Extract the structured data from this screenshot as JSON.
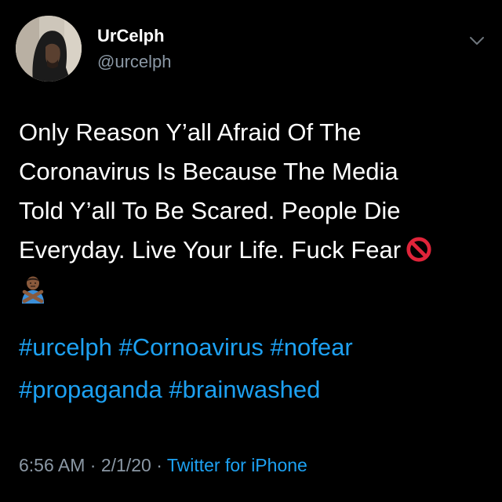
{
  "user": {
    "display_name": "UrCelph",
    "handle": "@urcelph"
  },
  "tweet": {
    "lines": [
      "Only Reason Y’all Afraid Of The",
      "Coronavirus Is Because The Media",
      "Told Y’all To Be Scared. People Die",
      "Everyday. Live Your Life. Fuck Fear"
    ],
    "emoji_end_of_line": "prohibited-icon",
    "emoji_next_line": "person-gesturing-no-icon",
    "hashtags_line1": [
      "#urcelph",
      "#Cornoavirus",
      "#nofear"
    ],
    "hashtags_line2": [
      "#propaganda",
      "#brainwashed"
    ]
  },
  "meta": {
    "time": "6:56 AM",
    "separator": "·",
    "date": "2/1/20",
    "source": "Twitter for iPhone"
  },
  "colors": {
    "background": "#000000",
    "text": "#ffffff",
    "secondary": "#8b98a5",
    "link": "#1da1f2"
  }
}
